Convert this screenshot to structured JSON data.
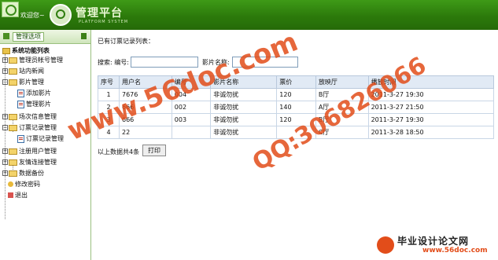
{
  "header": {
    "welcome": "欢迎您~",
    "platform_title": "管理平台",
    "platform_subtitle": "PLATFORM SYSTEM"
  },
  "sidebar": {
    "tab_label": "管理选项",
    "root_label": "系统功能列表",
    "items": [
      {
        "label": "管理员帐号管理",
        "type": "folder",
        "expanded": false
      },
      {
        "label": "站内新闻",
        "type": "folder",
        "expanded": false
      },
      {
        "label": "影片管理",
        "type": "folder",
        "expanded": true
      },
      {
        "label": "添加影片",
        "type": "doc"
      },
      {
        "label": "管理影片",
        "type": "doc"
      },
      {
        "label": "场次信息管理",
        "type": "folder",
        "expanded": false
      },
      {
        "label": "订票记录管理",
        "type": "folder",
        "expanded": true
      },
      {
        "label": "订票记录管理",
        "type": "doc"
      },
      {
        "label": "注册用户管理",
        "type": "folder",
        "expanded": false
      },
      {
        "label": "友情连接管理",
        "type": "folder",
        "expanded": false
      },
      {
        "label": "数据备份",
        "type": "folder",
        "expanded": false
      },
      {
        "label": "修改密码",
        "type": "key"
      },
      {
        "label": "退出",
        "type": "exit"
      }
    ]
  },
  "main": {
    "list_title": "已有订票记录列表：",
    "search": {
      "label_id": "搜索: 编号:",
      "label_name": "影片名称:",
      "id_value": "",
      "name_value": ""
    },
    "table": {
      "headers": [
        "序号",
        "用户名",
        "编号",
        "影片名称",
        "票价",
        "放映厅",
        "播放时间"
      ],
      "rows": [
        [
          "1",
          "7676",
          "004",
          "非诚勿扰",
          "120",
          "B厅",
          "2011-3-27 19:30"
        ],
        [
          "2",
          "666",
          "002",
          "非诚勿扰",
          "140",
          "A厅",
          "2011-3-27 21:50"
        ],
        [
          "3",
          "666",
          "003",
          "非诚勿扰",
          "120",
          "B厅",
          "2011-3-27 19:30"
        ],
        [
          "4",
          "22",
          "",
          "非诚勿扰",
          "",
          "C厅",
          "2011-3-28 18:50"
        ]
      ]
    },
    "footer_text": "以上数据共4条",
    "prev_button": "打印"
  },
  "watermark": {
    "url": "www.56doc.com",
    "qq": "QQ:306826066",
    "brand_name": "毕业设计论文网",
    "brand_url": "www.56doc.com"
  }
}
